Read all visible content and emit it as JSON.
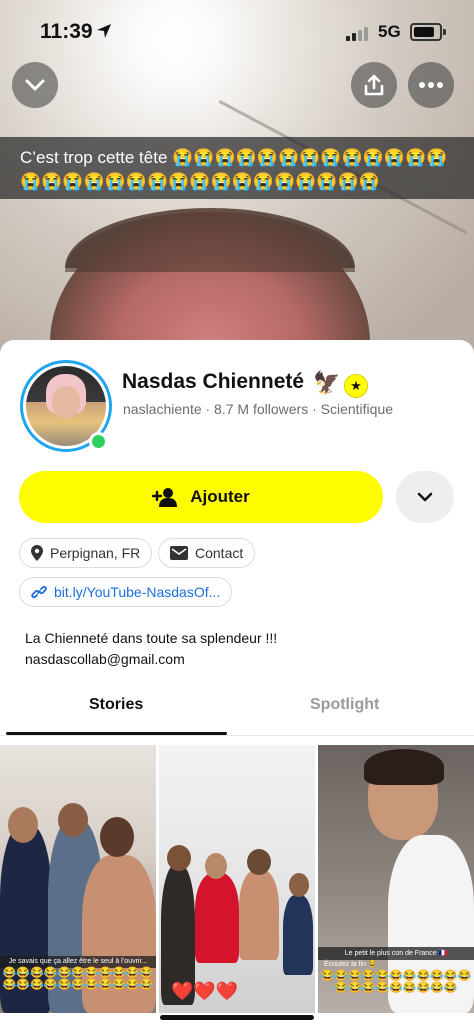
{
  "status_bar": {
    "time": "11:39",
    "network": "5G"
  },
  "icons": {
    "location_arrow": "location-arrow-icon",
    "signal": "signal-bars-icon",
    "battery": "battery-icon",
    "collapse": "chevron-down-icon",
    "share": "share-icon",
    "more": "more-dots-icon",
    "add_friend": "add-friend-icon",
    "expand": "chevron-down-icon",
    "pin": "location-pin-icon",
    "mail": "mail-icon",
    "link": "link-icon"
  },
  "snap": {
    "caption": "C’est trop cette tête 😭😭😭😭😭😭😭😭😭😭😭😭😭😭😭😭😭😭😭😭😭😭😭😭😭😭😭😭😭😭"
  },
  "profile": {
    "name": "Nasdas Chienneté",
    "name_emoji": "🦅",
    "verified_symbol": "★",
    "meta": "naslachiente · 8.7 M followers · Scientifique",
    "online": true
  },
  "actions": {
    "add_label": "Ajouter"
  },
  "chips": {
    "location": "Perpignan, FR",
    "contact": "Contact",
    "link": "bit.ly/YouTube-NasdasOf..."
  },
  "bio": {
    "line1": "La Chienneté dans toute sa splendeur !!!",
    "line2": "nasdascollab@gmail.com"
  },
  "tabs": [
    {
      "label": "Stories",
      "active": true
    },
    {
      "label": "Spotlight",
      "active": false
    }
  ],
  "stories": [
    {
      "caption": "Je savais que ça allez être le seul à l’ouvrir...",
      "emojis": "😂😂😂😂😂😂😂😂😂😂😂😂😂😂😂😂😂😂😂😂😂😂"
    },
    {
      "caption": "",
      "emojis": "❤️❤️❤️"
    },
    {
      "caption": "Le petit le plus con de France 🇫🇷",
      "caption2": "Écoutez la fin 😂",
      "emojis": "😂😂😂😂😂😂😂😂😂😂😂😂😂😂😂😂😂😂😂😂"
    }
  ],
  "colors": {
    "snap_yellow": "#FFFC00",
    "story_ring": "#1EA5F0",
    "link_blue": "#1A6FE0",
    "online_green": "#2ECF5A"
  }
}
